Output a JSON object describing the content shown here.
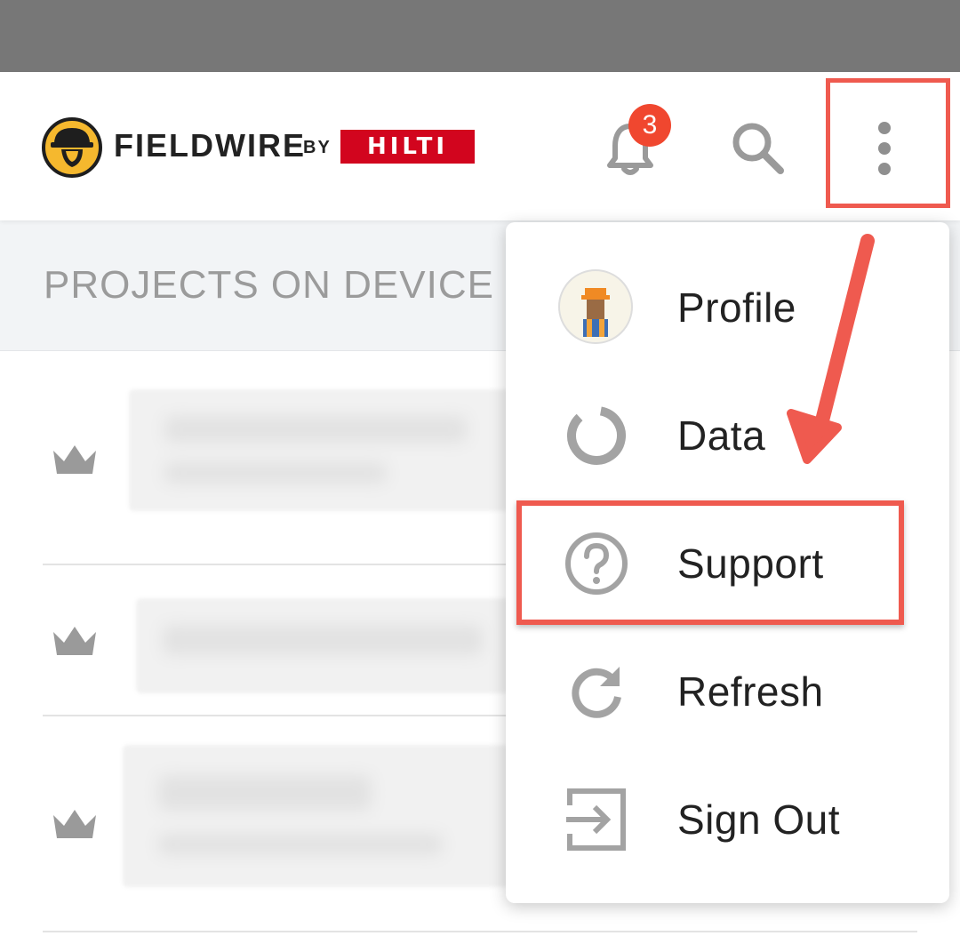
{
  "header": {
    "brand": "FIELDWIRE",
    "by": "BY",
    "partner": "HILTI",
    "notification_count": "3"
  },
  "section": {
    "title": "PROJECTS ON DEVICE"
  },
  "menu": {
    "items": [
      {
        "label": "Profile",
        "icon": "avatar"
      },
      {
        "label": "Data",
        "icon": "data-ring-icon"
      },
      {
        "label": "Support",
        "icon": "help-circle-icon"
      },
      {
        "label": "Refresh",
        "icon": "refresh-icon"
      },
      {
        "label": "Sign Out",
        "icon": "sign-out-icon"
      }
    ]
  },
  "colors": {
    "highlight": "#ef5a4f",
    "brand_red": "#d2051e",
    "logo_yellow": "#f5b82e",
    "badge": "#f0472f"
  }
}
